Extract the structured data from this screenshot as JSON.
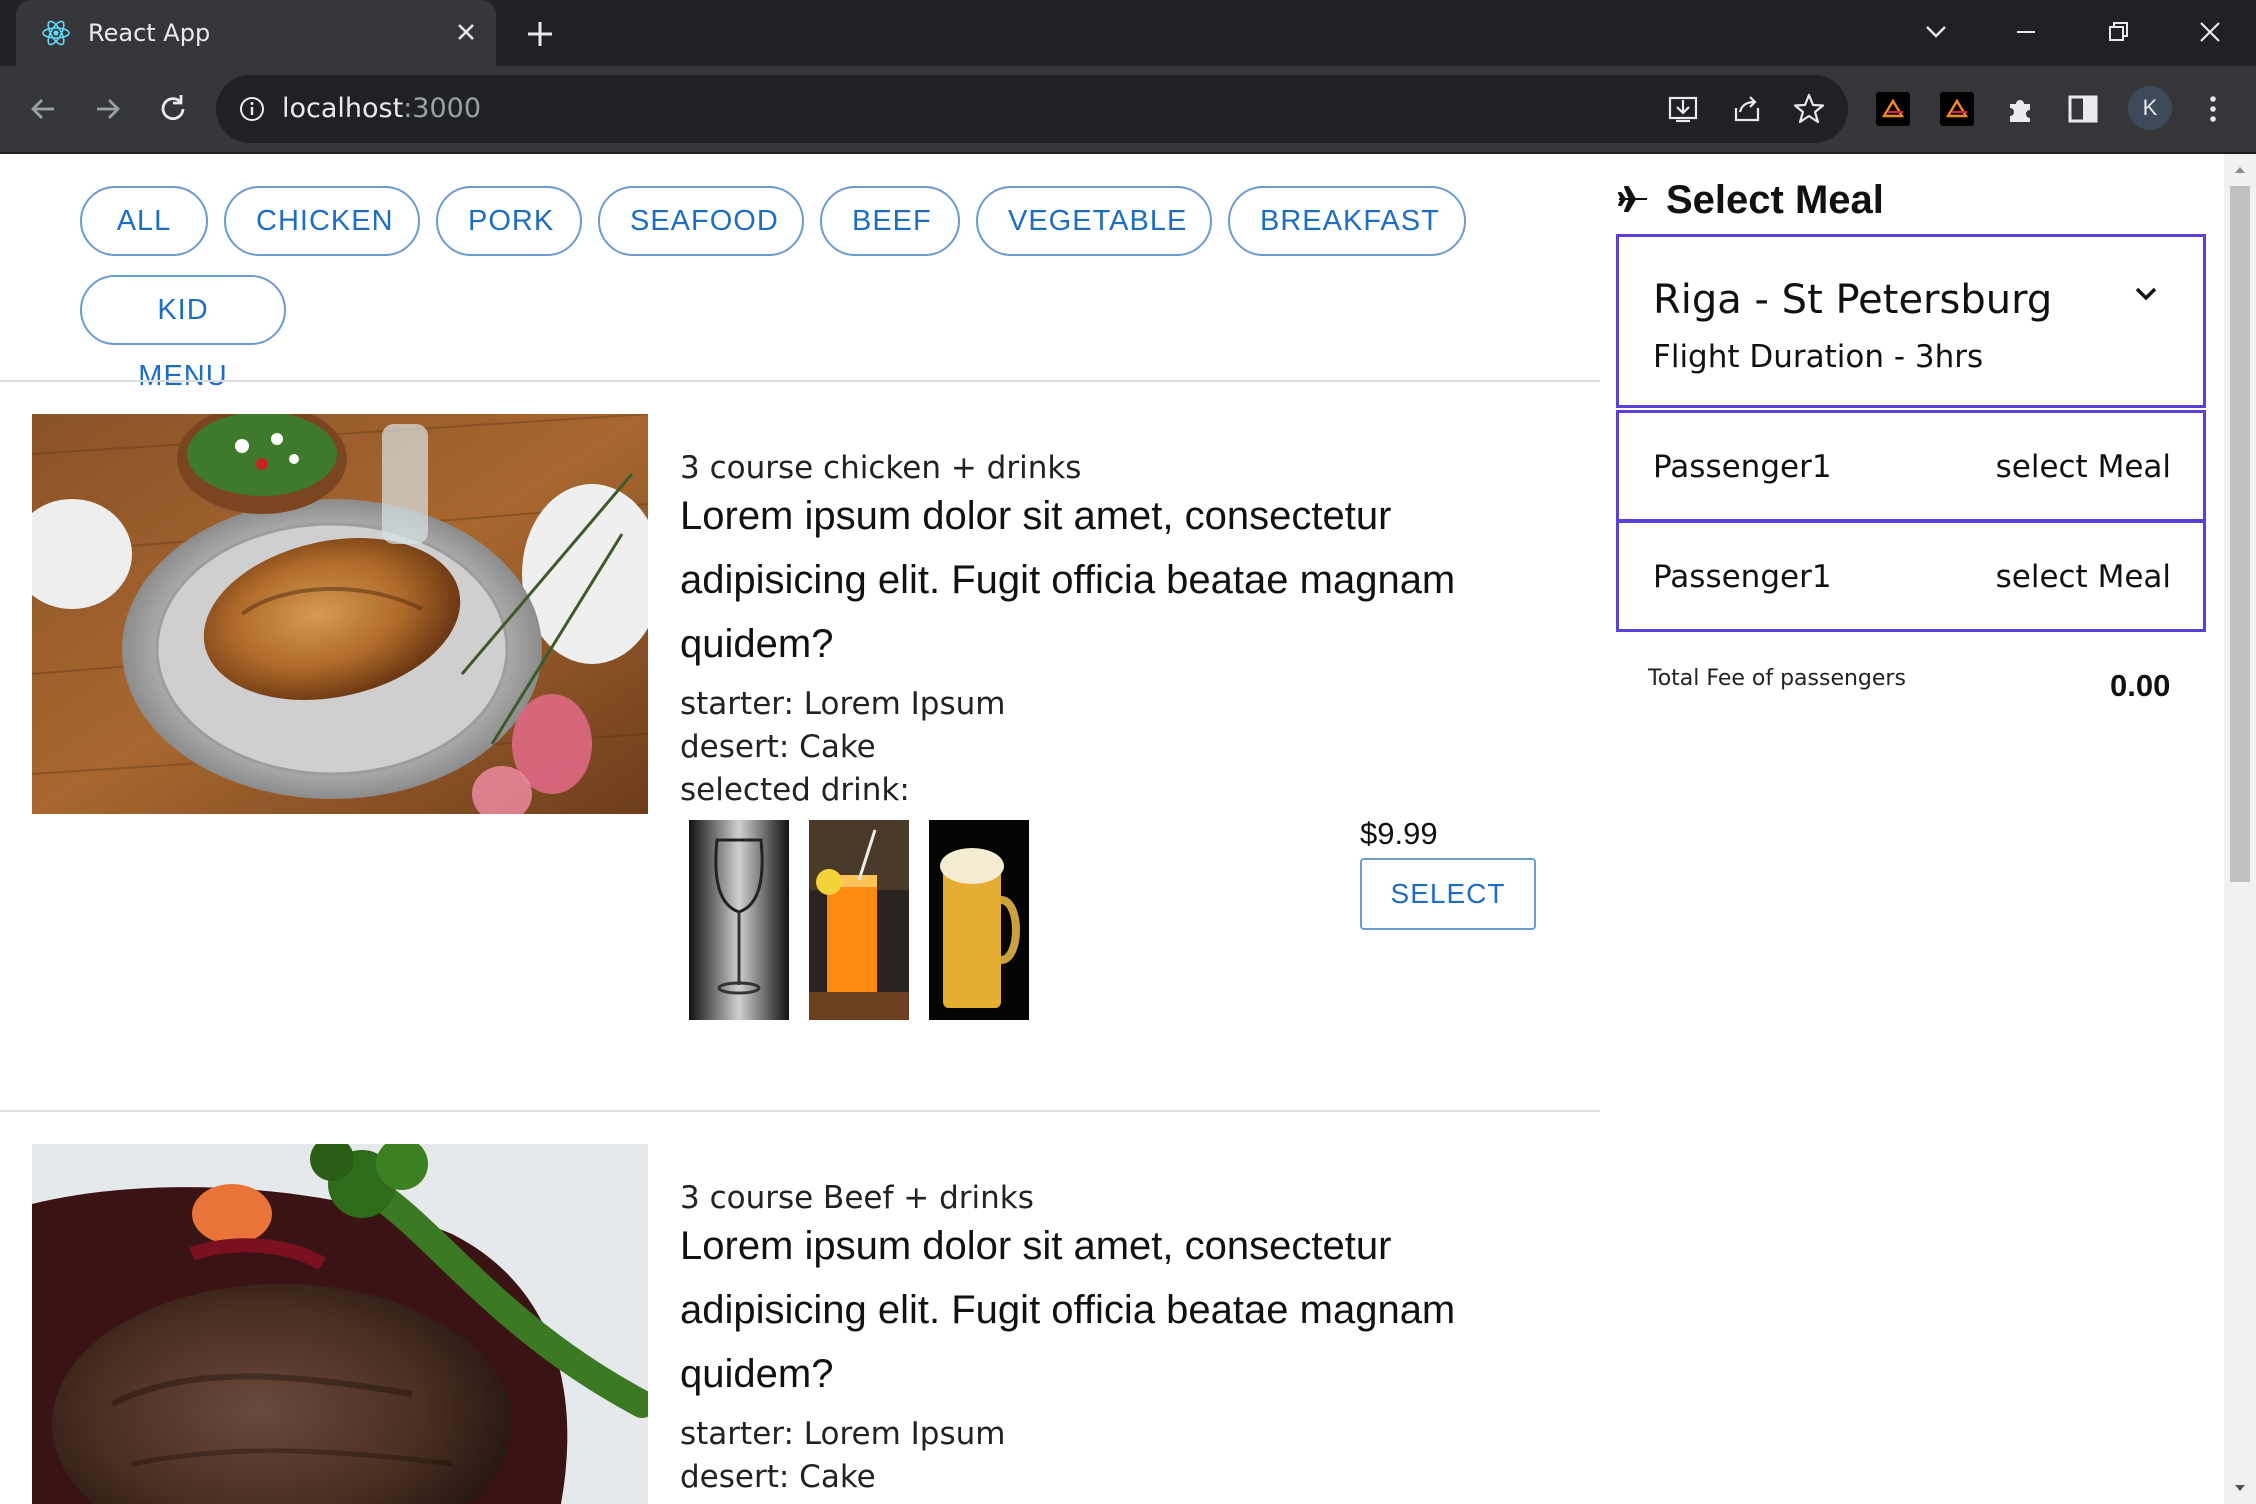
{
  "browser": {
    "tab_title": "React App",
    "url_host": "localhost",
    "url_port": ":3000",
    "profile_initial": "K"
  },
  "filters": [
    "ALL",
    "CHICKEN",
    "PORK",
    "SEAFOOD",
    "BEEF",
    "VEGETABLE",
    "BREAKFAST",
    "KID MENU"
  ],
  "meals": [
    {
      "subtitle": "3 course chicken + drinks",
      "description": "Lorem ipsum dolor sit amet, consectetur adipisicing elit. Fugit officia beatae magnam quidem?",
      "starter": "starter: Lorem Ipsum",
      "desert": "desert: Cake",
      "drink_label": "selected drink:",
      "price": "$9.99",
      "select_label": "SELECT"
    },
    {
      "subtitle": "3 course Beef + drinks",
      "description": "Lorem ipsum dolor sit amet, consectetur adipisicing elit. Fugit officia beatae magnam quidem?",
      "starter": "starter: Lorem Ipsum",
      "desert": "desert: Cake"
    }
  ],
  "panel": {
    "title": "Select Meal",
    "route": "Riga - St Petersburg",
    "duration": "Flight Duration - 3hrs",
    "passengers": [
      {
        "name": "Passenger1",
        "action": "select Meal"
      },
      {
        "name": "Passenger1",
        "action": "select Meal"
      }
    ],
    "total_label": "Total Fee of passengers",
    "total_value": "0.00"
  },
  "colors": {
    "accent_blue": "#1e6dc4",
    "panel_border": "#5b3fd8"
  }
}
